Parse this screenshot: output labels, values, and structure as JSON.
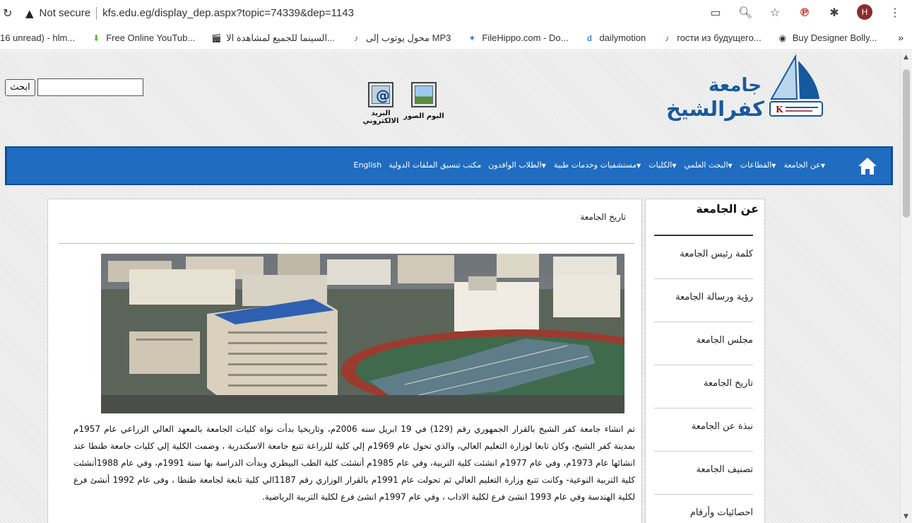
{
  "browser": {
    "security_label": "Not secure",
    "url": "kfs.edu.eg/display_dep.aspx?topic=74339&dep=1143",
    "bookmarks": [
      {
        "icon": "mail-icon",
        "label": "16 unread) - hlm..."
      },
      {
        "icon": "download-icon",
        "label": "Free Online YouTub..."
      },
      {
        "icon": "clapper-icon",
        "label": "السينما للجميع لمشاهدة الا..."
      },
      {
        "icon": "mp3-icon",
        "label": "محول يوتوب إلى MP3"
      },
      {
        "icon": "filehippo-icon",
        "label": "FileHippo.com - Do..."
      },
      {
        "icon": "dailymotion-icon",
        "label": "dailymotion"
      },
      {
        "icon": "mp3-icon",
        "label": "гости из будущего..."
      },
      {
        "icon": "globe-icon",
        "label": "Buy Designer Bolly..."
      }
    ],
    "more_label": "»",
    "avatar_initial": "H"
  },
  "header": {
    "search_button": "ابحث",
    "search_placeholder": "",
    "mail_label": "البريد الالكتروني",
    "photos_label": "البوم الصور",
    "logo_line1": "جامعة",
    "logo_line2": "كفرالشيخ"
  },
  "nav": {
    "items": [
      "عن الجامعة",
      "القطاعات",
      "البحث العلمي",
      "الكليات",
      "مستشفيات وخدمات طبية",
      "الطلاب الوافدون",
      "مكتب تنسيق الملفات الدولية",
      "English"
    ]
  },
  "sidebar": {
    "title": "عن الجامعة",
    "items": [
      "كلمة رئيس الجامعة",
      "رؤية ورسالة الجامعة",
      "مجلس الجامعة",
      "تاريخ الجامعة",
      "نبذة عن الجامعة",
      "تصنيف الجامعة",
      "احصائيات وأرقام"
    ]
  },
  "main": {
    "title": "تاريخ الجامعة",
    "paragraph": "تم انشاء جامعة كفر الشيخ بالقرار الجمهوري رقم (129) في 19 ابريل سنه 2006م، وتاريخيا بدأت نواة كليات الجامعة بالمعهد العالي الزراعي عام 1957م بمدينة كفر الشيخ، وكان تابعا لوزارة التعليم العالي، والذي تحول عام 1969م إلي كلية للزراعة تتبع جامعة الاسكندرية ، وضمت الكلية إلي كليات جامعة طنطا عند انشائها عام 1973م، وفي عام 1977م انشئت كلية التربية، وفي عام 1985م أنشئت كلية الطب البيطري وبدأت الدراسة بها سنة 1991م، وفي عام 1988أنشئت كلية التربية النوعية- وكانت تتبع وزارة التعليم العالي ثم تحولت عام 1991م بالقرار الوزاري رقم 1187الي كلية تابعة لجامعة طنطا ، وفى عام 1992 أنشئ فرع لكلية الهندسة وفي عام 1993 انشئ فرع لكلية الاداب ، وفي عام 1997م انشئ فرع لكلية التربية الرياضية."
  },
  "colors": {
    "nav_blue": "#1f6cc0",
    "logo_blue": "#17599e"
  }
}
